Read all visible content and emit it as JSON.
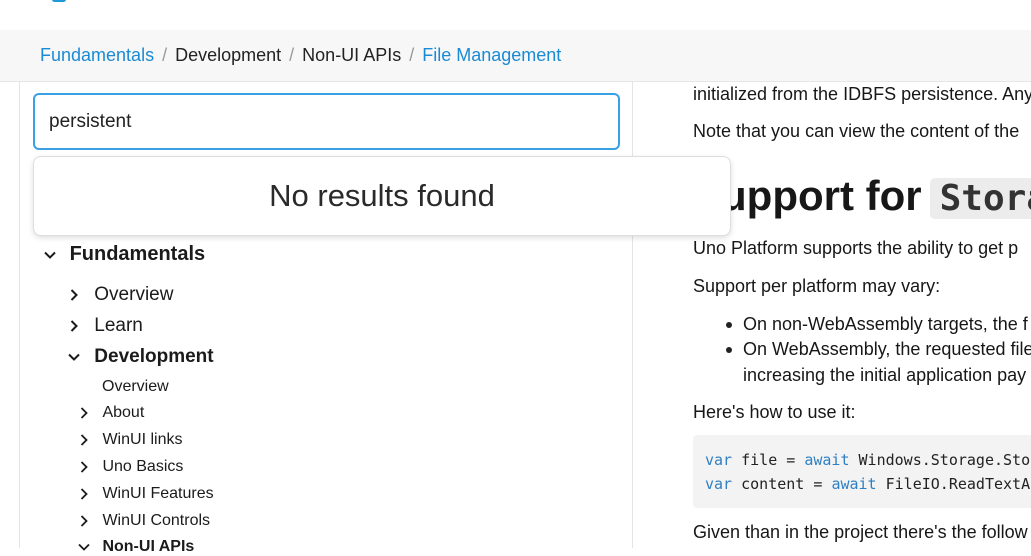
{
  "breadcrumb": {
    "items": [
      {
        "label": "Fundamentals"
      },
      {
        "label": "Development"
      },
      {
        "label": "Non-UI APIs"
      },
      {
        "label": "File Management"
      }
    ],
    "separator": "/"
  },
  "search": {
    "value": "persistent",
    "no_results": "No results found"
  },
  "tree": {
    "root": "Fundamentals",
    "level1": [
      {
        "label": "Overview"
      },
      {
        "label": "Learn"
      },
      {
        "label": "Development"
      }
    ],
    "level2": [
      {
        "label": "Overview"
      },
      {
        "label": "About"
      },
      {
        "label": "WinUI links"
      },
      {
        "label": "Uno Basics"
      },
      {
        "label": "WinUI Features"
      },
      {
        "label": "WinUI Controls"
      },
      {
        "label": "Non-UI APIs"
      }
    ]
  },
  "article": {
    "line1": "initialized from the IDBFS persistence. Any",
    "line2": "Note that you can view the content of the",
    "heading": "Support for",
    "heading_code": "Stora",
    "p1": "Uno Platform supports the ability to get p",
    "p2": "Support per platform may vary:",
    "bullet1": "On non-WebAssembly targets, the f",
    "bullet2a": "On WebAssembly, the requested file",
    "bullet2b": "increasing the initial application pay",
    "p3": "Here's how to use it:",
    "code": {
      "l1_kw": "var",
      "l1_a": " file = ",
      "l1_kw2": "await",
      "l1_b": " Windows.Storage.Stor",
      "l2_kw": "var",
      "l2_a": " content = ",
      "l2_kw2": "await",
      "l2_b": " FileIO.ReadTextAs"
    },
    "p4": "Given than in the project there's the follow"
  },
  "colors": {
    "link": "#1a8ad4",
    "focus": "#3aa0e4",
    "keyword": "#2f7fc3"
  }
}
